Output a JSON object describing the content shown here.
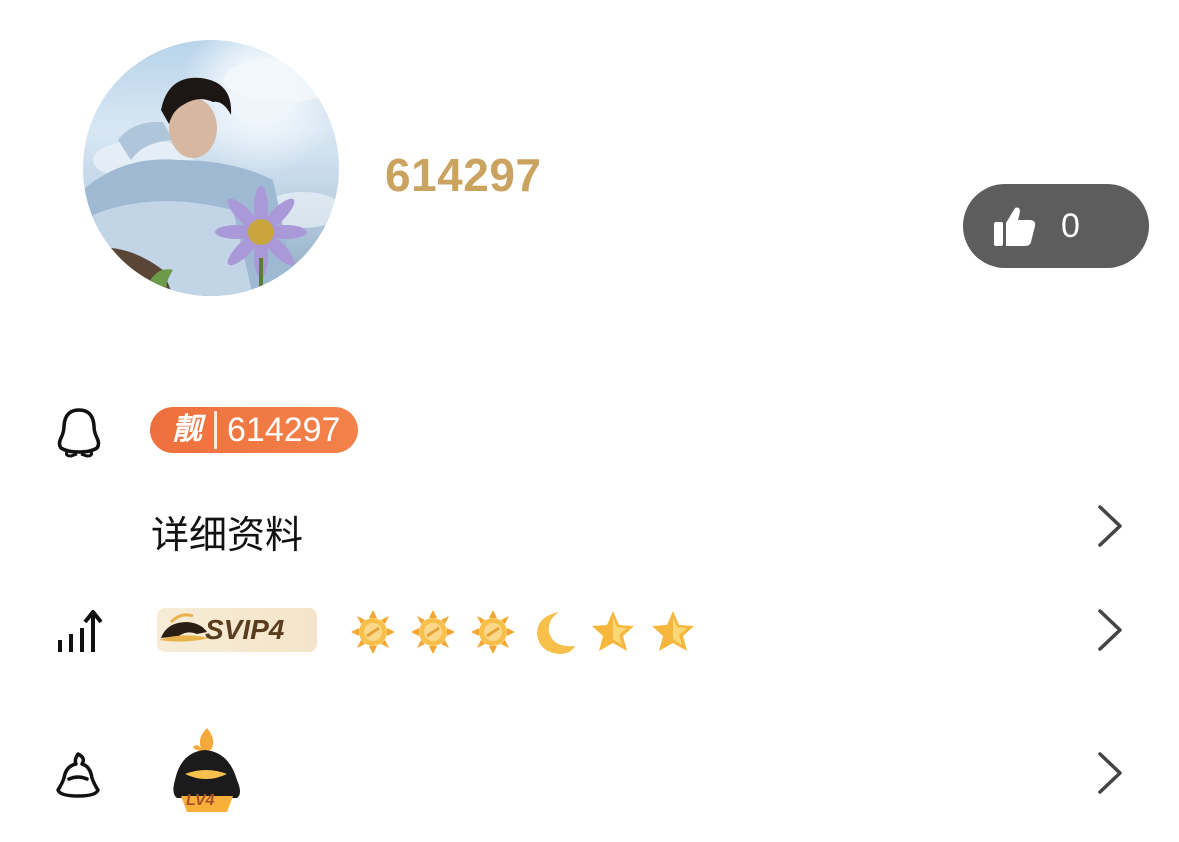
{
  "profile": {
    "nickname": "614297",
    "avatar_icon": "avatar-photo"
  },
  "like_button": {
    "icon": "thumbs-up-icon",
    "count": "0"
  },
  "qq_row": {
    "icon": "penguin-icon",
    "badge_char": "靓",
    "number": "614297"
  },
  "detail_row": {
    "label": "详细资料"
  },
  "vip_row": {
    "icon": "growth-icon",
    "badge_text": "SVIP4",
    "levels": [
      "sun",
      "sun",
      "sun",
      "moon",
      "star",
      "star"
    ]
  },
  "lv_row": {
    "icon": "flame-penguin-icon",
    "badge_text": "LV4"
  },
  "colors": {
    "nickname": "#c9a35f",
    "badge": "#ee6f3d",
    "like_bg": "#5d5d5d"
  }
}
